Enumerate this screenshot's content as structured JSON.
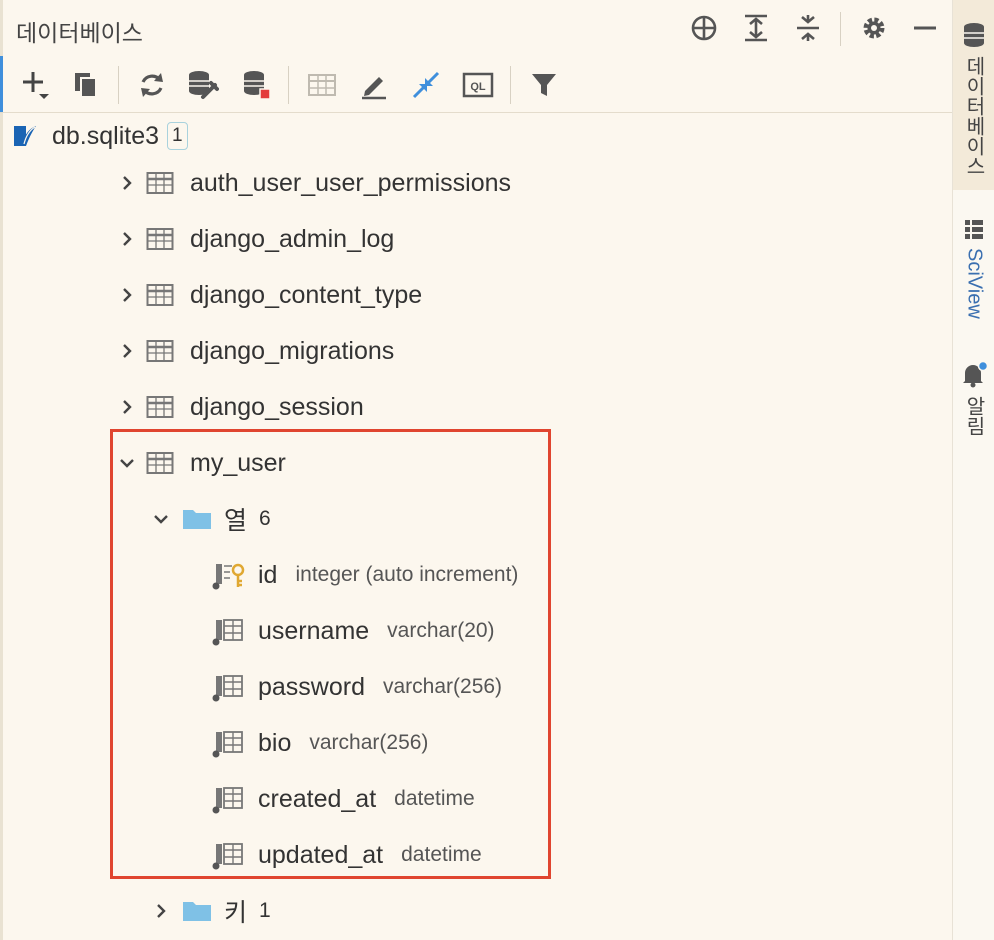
{
  "header": {
    "title": "데이터베이스",
    "icons": [
      "crosshair-icon",
      "expand-all-icon",
      "collapse-all-icon",
      "gear-icon",
      "minimize-icon"
    ]
  },
  "toolbar": {
    "icons": [
      "add-icon",
      "duplicate-icon",
      "refresh-icon",
      "data-source-properties-icon",
      "stop-icon",
      "table-editor-icon",
      "edit-icon",
      "compare-icon",
      "console-icon",
      "filter-icon"
    ]
  },
  "tree": {
    "datasource": {
      "name": "db.sqlite3",
      "badge": "1"
    },
    "tables": [
      {
        "name": "auth_user_user_permissions"
      },
      {
        "name": "django_admin_log"
      },
      {
        "name": "django_content_type"
      },
      {
        "name": "django_migrations"
      },
      {
        "name": "django_session"
      }
    ],
    "expanded_table": {
      "name": "my_user",
      "columns_folder": {
        "label": "열",
        "count": "6"
      },
      "columns": [
        {
          "name": "id",
          "type": "integer (auto increment)",
          "primary_key": true
        },
        {
          "name": "username",
          "type": "varchar(20)"
        },
        {
          "name": "password",
          "type": "varchar(256)"
        },
        {
          "name": "bio",
          "type": "varchar(256)"
        },
        {
          "name": "created_at",
          "type": "datetime"
        },
        {
          "name": "updated_at",
          "type": "datetime"
        }
      ],
      "keys_folder": {
        "label": "키",
        "count": "1"
      }
    }
  },
  "right_sidebar": {
    "tabs": [
      {
        "label": "데이터베이스",
        "icon": "database-icon",
        "active": true
      },
      {
        "label": "SciView",
        "icon": "grid-icon"
      },
      {
        "label": "알림",
        "icon": "bell-icon"
      }
    ]
  },
  "colors": {
    "background": "#fcf7ee",
    "highlight_border": "#e0452f",
    "folder": "#7fc1e6",
    "key": "#e0a832",
    "accent_blue": "#3f8fdc"
  }
}
